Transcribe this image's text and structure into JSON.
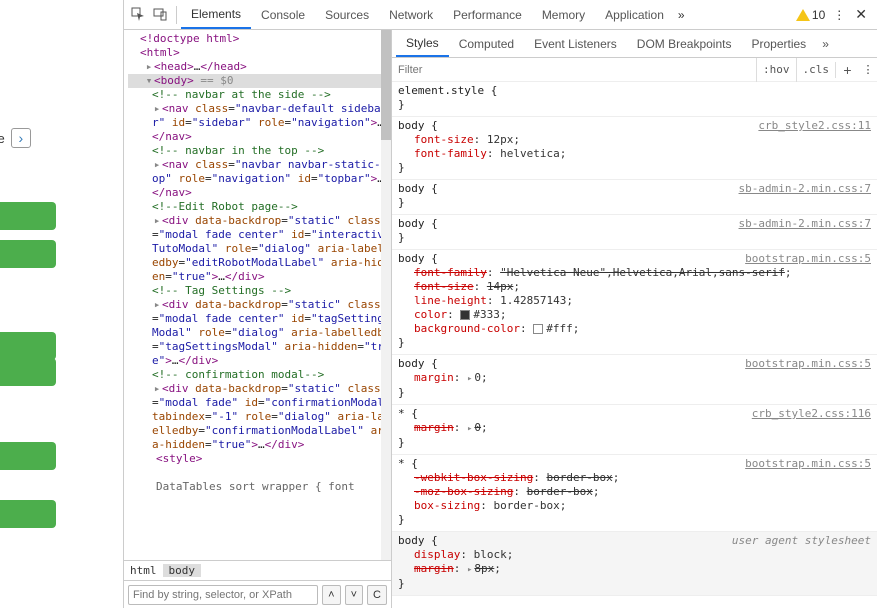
{
  "bg": {
    "customize": "stomize"
  },
  "toolbar": {
    "tabs": [
      "Elements",
      "Console",
      "Sources",
      "Network",
      "Performance",
      "Memory",
      "Application"
    ],
    "activeTab": 0,
    "warnCount": "10"
  },
  "elements": {
    "lines": [
      {
        "indent": 8,
        "arrow": "",
        "raw": "<span class='t'>&lt;!doctype html&gt;</span>"
      },
      {
        "indent": 8,
        "arrow": "",
        "raw": "<span class='t'>&lt;html&gt;</span>"
      },
      {
        "indent": 12,
        "arrow": "▸",
        "raw": "<span class='t'>&lt;head&gt;</span>…<span class='t'>&lt;/head&gt;</span>"
      },
      {
        "indent": 12,
        "arrow": "▾",
        "sel": true,
        "raw": "<span class='t'>&lt;body&gt;</span> <span class='g'>== $0</span>"
      },
      {
        "indent": 20,
        "arrow": "",
        "raw": "<span class='c'>&lt;!-- navbar at the side --&gt;</span>"
      },
      {
        "indent": 20,
        "arrow": "▸",
        "raw": "<span class='t'>&lt;nav </span><span class='a'>class</span>=<span class='q'>\"</span><span class='v'>navbar-default sidebar</span><span class='q'>\"</span> <span class='a'>id</span>=<span class='q'>\"</span><span class='v'>sidebar</span><span class='q'>\"</span> <span class='a'>role</span>=<span class='q'>\"</span><span class='v'>navigation</span><span class='q'>\"</span><span class='t'>&gt;</span>…<span class='t'>&lt;/nav&gt;</span>"
      },
      {
        "indent": 20,
        "arrow": "",
        "raw": "<span class='c'>&lt;!-- navbar in the top --&gt;</span>"
      },
      {
        "indent": 20,
        "arrow": "▸",
        "raw": "<span class='t'>&lt;nav </span><span class='a'>class</span>=<span class='q'>\"</span><span class='v'>navbar navbar-static-top</span><span class='q'>\"</span> <span class='a'>role</span>=<span class='q'>\"</span><span class='v'>navigation</span><span class='q'>\"</span> <span class='a'>id</span>=<span class='q'>\"</span><span class='v'>topbar</span><span class='q'>\"</span><span class='t'>&gt;</span>…<span class='t'>&lt;/nav&gt;</span>"
      },
      {
        "indent": 20,
        "arrow": "",
        "raw": "<span class='c'>&lt;!--Edit Robot page--&gt;</span>"
      },
      {
        "indent": 20,
        "arrow": "▸",
        "raw": "<span class='t'>&lt;div </span><span class='a'>data-backdrop</span>=<span class='q'>\"</span><span class='v'>static</span><span class='q'>\"</span> <span class='a'>class</span>=<span class='q'>\"</span><span class='v'>modal fade center</span><span class='q'>\"</span> <span class='a'>id</span>=<span class='q'>\"</span><span class='v'>interactiveTutoModal</span><span class='q'>\"</span> <span class='a'>role</span>=<span class='q'>\"</span><span class='v'>dialog</span><span class='q'>\"</span> <span class='a'>aria-labelledby</span>=<span class='q'>\"</span><span class='v'>editRobotModalLabel</span><span class='q'>\"</span> <span class='a'>aria-hidden</span>=<span class='q'>\"</span><span class='v'>true</span><span class='q'>\"</span><span class='t'>&gt;</span>…<span class='t'>&lt;/div&gt;</span>"
      },
      {
        "indent": 20,
        "arrow": "",
        "raw": "<span class='c'>&lt;!-- Tag Settings --&gt;</span>"
      },
      {
        "indent": 20,
        "arrow": "▸",
        "raw": "<span class='t'>&lt;div </span><span class='a'>data-backdrop</span>=<span class='q'>\"</span><span class='v'>static</span><span class='q'>\"</span> <span class='a'>class</span>=<span class='q'>\"</span><span class='v'>modal fade center</span><span class='q'>\"</span> <span class='a'>id</span>=<span class='q'>\"</span><span class='v'>tagSettingsModal</span><span class='q'>\"</span> <span class='a'>role</span>=<span class='q'>\"</span><span class='v'>dialog</span><span class='q'>\"</span> <span class='a'>aria-labelledby</span>=<span class='q'>\"</span><span class='v'>tagSettingsModal</span><span class='q'>\"</span> <span class='a'>aria-hidden</span>=<span class='q'>\"</span><span class='v'>true</span><span class='q'>\"</span><span class='t'>&gt;</span>…<span class='t'>&lt;/div&gt;</span>"
      },
      {
        "indent": 20,
        "arrow": "",
        "raw": "<span class='c'>&lt;!-- confirmation modal--&gt;</span>"
      },
      {
        "indent": 20,
        "arrow": "▸",
        "raw": "<span class='t'>&lt;div </span><span class='a'>data-backdrop</span>=<span class='q'>\"</span><span class='v'>static</span><span class='q'>\"</span> <span class='a'>class</span>=<span class='q'>\"</span><span class='v'>modal fade</span><span class='q'>\"</span> <span class='a'>id</span>=<span class='q'>\"</span><span class='v'>confirmationModal</span><span class='q'>\"</span> <span class='a'>tabindex</span>=<span class='q'>\"</span><span class='v'>-1</span><span class='q'>\"</span> <span class='a'>role</span>=<span class='q'>\"</span><span class='v'>dialog</span><span class='q'>\"</span> <span class='a'>aria-labelledby</span>=<span class='q'>\"</span><span class='v'>confirmationModalLabel</span><span class='q'>\"</span> <span class='a'>aria-hidden</span>=<span class='q'>\"</span><span class='v'>true</span><span class='q'>\"</span><span class='t'>&gt;</span>…<span class='t'>&lt;/div&gt;</span>"
      },
      {
        "indent": 24,
        "arrow": "",
        "raw": "<span class='t'>&lt;style&gt;</span>"
      },
      {
        "indent": 0,
        "arrow": "",
        "raw": "&nbsp;"
      },
      {
        "indent": 24,
        "arrow": "",
        "raw": "<span class='g' style='color:#666'>DataTables sort wrapper { font</span>"
      }
    ],
    "crumbs": [
      "html",
      "body"
    ],
    "activeCrumb": 1,
    "findPlaceholder": "Find by string, selector, or XPath",
    "cancelLabel": "C"
  },
  "stylesPanel": {
    "tabs": [
      "Styles",
      "Computed",
      "Event Listeners",
      "DOM Breakpoints",
      "Properties"
    ],
    "activeTab": 0,
    "filterPlaceholder": "Filter",
    "chips": [
      ":hov",
      ".cls"
    ]
  },
  "rules": [
    {
      "selector": "element.style",
      "src": "",
      "decls": []
    },
    {
      "selector": "body",
      "src": "crb_style2.css:11",
      "decls": [
        {
          "prop": "font-size",
          "val": "12px"
        },
        {
          "prop": "font-family",
          "val": "helvetica"
        }
      ]
    },
    {
      "selector": "body",
      "src": "sb-admin-2.min.css:7",
      "decls": []
    },
    {
      "selector": "body",
      "src": "sb-admin-2.min.css:7",
      "decls": []
    },
    {
      "selector": "body",
      "src": "bootstrap.min.css:5",
      "decls": [
        {
          "prop": "font-family",
          "val": "\"Helvetica Neue\",Helvetica,Arial,sans-serif",
          "strike": true
        },
        {
          "prop": "font-size",
          "val": "14px",
          "strike": true
        },
        {
          "prop": "line-height",
          "val": "1.42857143"
        },
        {
          "prop": "color",
          "val": "#333",
          "swatch": "#333"
        },
        {
          "prop": "background-color",
          "val": "#fff",
          "swatch": "#fff"
        }
      ]
    },
    {
      "selector": "body",
      "src": "bootstrap.min.css:5",
      "decls": [
        {
          "prop": "margin",
          "val": "0",
          "tri": true
        }
      ]
    },
    {
      "selector": "*",
      "src": "crb_style2.css:116",
      "decls": [
        {
          "prop": "margin",
          "val": "0",
          "strike": true,
          "tri": true
        }
      ]
    },
    {
      "selector": "*",
      "src": "bootstrap.min.css:5",
      "decls": [
        {
          "prop": "-webkit-box-sizing",
          "val": "border-box",
          "strike": true
        },
        {
          "prop": "-moz-box-sizing",
          "val": "border-box",
          "strike": true
        },
        {
          "prop": "box-sizing",
          "val": "border-box"
        }
      ]
    },
    {
      "selector": "body",
      "src": "user agent stylesheet",
      "ua": true,
      "decls": [
        {
          "prop": "display",
          "val": "block"
        },
        {
          "prop": "margin",
          "val": "8px",
          "strike": true,
          "tri": true
        }
      ]
    }
  ]
}
